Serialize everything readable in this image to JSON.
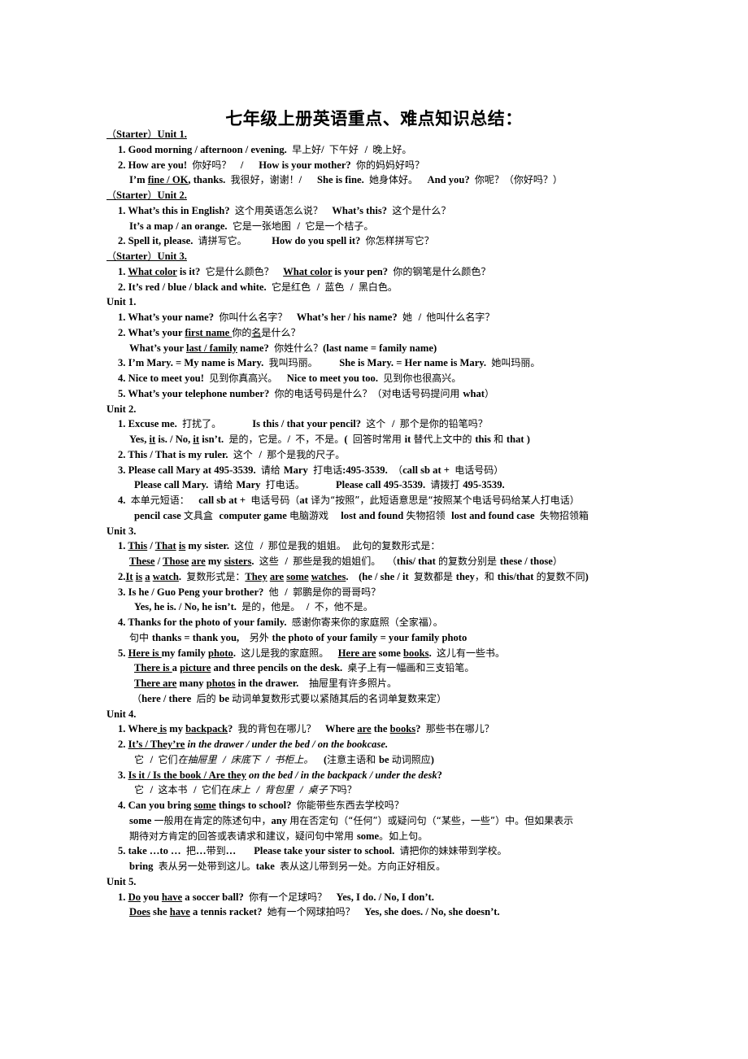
{
  "document": {
    "title": "七年级上册英语重点、难点知识总结：",
    "lines": [
      {
        "indent": 0,
        "segments": [
          {
            "t": "（Starter）Unit 1.",
            "u": true
          }
        ]
      },
      {
        "indent": 1,
        "segments": [
          {
            "t": "1. Good morning / afternoon / evening.  早上好/  下午好  /  晚上好。"
          }
        ]
      },
      {
        "indent": 1,
        "segments": [
          {
            "t": "2. How are you!  你好吗？   /      How is your mother?  你的妈妈好吗？"
          }
        ]
      },
      {
        "indent": 2,
        "segments": [
          {
            "t": "I’m "
          },
          {
            "t": "fine / OK",
            "u": true
          },
          {
            "t": ", thanks.  我很好，谢谢！/      She is fine.  她身体好。   And you?  你呢？（你好吗？）"
          }
        ]
      },
      {
        "indent": 0,
        "segments": [
          {
            "t": "（Starter）Unit 2.",
            "u": true
          }
        ]
      },
      {
        "indent": 1,
        "segments": [
          {
            "t": "1. What’s this in English?  这个用英语怎么说？   What’s this?  这个是什么？"
          }
        ]
      },
      {
        "indent": 2,
        "segments": [
          {
            "t": "It’s a map / an orange.  它是一张地图  /  它是一个桔子。"
          }
        ]
      },
      {
        "indent": 1,
        "segments": [
          {
            "t": "2. Spell it, please.  请拼写它。        How do you spell it?  你怎样拼写它？"
          }
        ]
      },
      {
        "indent": 0,
        "segments": [
          {
            "t": "（Starter）Unit 3.",
            "u": true
          }
        ]
      },
      {
        "indent": 1,
        "segments": [
          {
            "t": "1. "
          },
          {
            "t": "What color",
            "u": true
          },
          {
            "t": " is it?  它是什么颜色？   "
          },
          {
            "t": "What color",
            "u": true
          },
          {
            "t": " is your pen?  你的钢笔是什么颜色？"
          }
        ]
      },
      {
        "indent": 1,
        "segments": [
          {
            "t": "2. It’s red / blue / black and white.  它是红色  /  蓝色  /  黑白色。"
          }
        ]
      },
      {
        "indent": 0,
        "segments": [
          {
            "t": "Unit 1."
          }
        ]
      },
      {
        "indent": 1,
        "segments": [
          {
            "t": "1. What’s your name?  你叫什么名字？   What’s her / his name?  她  /  他叫什么名字？"
          }
        ]
      },
      {
        "indent": 1,
        "segments": [
          {
            "t": "2. What’s your "
          },
          {
            "t": "first name ",
            "u": true
          },
          {
            "t": "你的"
          },
          {
            "t": "名",
            "u": true
          },
          {
            "t": "是什么？"
          }
        ]
      },
      {
        "indent": 2,
        "segments": [
          {
            "t": "What’s your "
          },
          {
            "t": "last / family",
            "u": true
          },
          {
            "t": " name?  你姓什么？(last name = family name)"
          }
        ]
      },
      {
        "indent": 1,
        "segments": [
          {
            "t": "3. I’m Mary. = My name is Mary.  我叫玛丽。       She is Mary. = Her name is Mary.  她叫玛丽。"
          }
        ]
      },
      {
        "indent": 1,
        "segments": [
          {
            "t": "4. Nice to meet you!  见到你真高兴。   Nice to meet you too.  见到你也很高兴。"
          }
        ]
      },
      {
        "indent": 1,
        "segments": [
          {
            "t": "5. What’s your telephone number?  你的电话号码是什么？（对电话号码提问用 what）"
          }
        ]
      },
      {
        "indent": 0,
        "segments": [
          {
            "t": "Unit 2."
          }
        ]
      },
      {
        "indent": 1,
        "segments": [
          {
            "t": "1. Excuse me.  打扰了。          Is this / that your pencil?  这个  /  那个是你的铅笔吗？"
          }
        ]
      },
      {
        "indent": 2,
        "segments": [
          {
            "t": "Yes, "
          },
          {
            "t": "it",
            "u": true
          },
          {
            "t": " is. / No, "
          },
          {
            "t": "it",
            "u": true
          },
          {
            "t": " isn’t.  是的，它是。/  不，不是。(  回答时常用 it 替代上文中的 this 和 that )"
          }
        ]
      },
      {
        "indent": 1,
        "segments": [
          {
            "t": "2. This / That is my ruler.  这个  /  那个是我的尺子。"
          }
        ]
      },
      {
        "indent": 1,
        "segments": [
          {
            "t": "3. Please call Mary at 495-3539.  请给 Mary  打电话:495-3539.  （call sb at +  电话号码）"
          }
        ]
      },
      {
        "indent": 3,
        "segments": [
          {
            "t": "Please call Mary.  请给 Mary  打电话。          Please call 495-3539.  请拨打 495-3539."
          }
        ]
      },
      {
        "indent": 1,
        "segments": [
          {
            "t": "4.  本单元短语：   call sb at +  电话号码（at 译为“按照”，此短语意思是“按照某个电话号码给某人打电话）"
          }
        ]
      },
      {
        "indent": 3,
        "segments": [
          {
            "t": "pencil case 文具盒  computer game 电脑游戏    lost and found 失物招领  lost and found case  失物招领箱"
          }
        ]
      },
      {
        "indent": 0,
        "segments": [
          {
            "t": "Unit 3."
          }
        ]
      },
      {
        "indent": 1,
        "segments": [
          {
            "t": "1. "
          },
          {
            "t": "This",
            "u": true
          },
          {
            "t": " / "
          },
          {
            "t": "That",
            "u": true
          },
          {
            "t": " "
          },
          {
            "t": "is",
            "u": true
          },
          {
            "t": " my sister.  这位  /  那位是我的姐姐。  此句的复数形式是："
          }
        ]
      },
      {
        "indent": 2,
        "segments": [
          {
            "t": "These",
            "u": true
          },
          {
            "t": " / "
          },
          {
            "t": "Those",
            "u": true
          },
          {
            "t": " "
          },
          {
            "t": "are",
            "u": true
          },
          {
            "t": " my "
          },
          {
            "t": "sisters",
            "u": true
          },
          {
            "t": ".  这些  /  那些是我的姐姐们。  （this/ that 的复数分别是 these / those）"
          }
        ]
      },
      {
        "indent": 1,
        "segments": [
          {
            "t": "2."
          },
          {
            "t": "It",
            "u": true
          },
          {
            "t": " "
          },
          {
            "t": "is",
            "u": true
          },
          {
            "t": " "
          },
          {
            "t": "a",
            "u": true
          },
          {
            "t": " "
          },
          {
            "t": "watch",
            "u": true
          },
          {
            "t": ".  复数形式是："
          },
          {
            "t": "They",
            "u": true
          },
          {
            "t": " "
          },
          {
            "t": "are",
            "u": true
          },
          {
            "t": " "
          },
          {
            "t": "some",
            "u": true
          },
          {
            "t": " "
          },
          {
            "t": "watches",
            "u": true
          },
          {
            "t": ".    (he / she / it  复数都是 they，和 this/that 的复数不同)"
          }
        ]
      },
      {
        "indent": 1,
        "segments": [
          {
            "t": "3. Is he / Guo Peng your brother?  他  /  郭鹏是你的哥哥吗？"
          }
        ]
      },
      {
        "indent": 3,
        "segments": [
          {
            "t": "Yes, he is. / No, he isn’t.  是的，他是。  /  不，他不是。"
          }
        ]
      },
      {
        "indent": 1,
        "segments": [
          {
            "t": "4. Thanks for the photo of your family.  感谢你寄来你的家庭照（全家福）。"
          }
        ]
      },
      {
        "indent": 2,
        "segments": [
          {
            "t": "句中 thanks = thank you,    另外 the photo of your family = your family photo"
          }
        ]
      },
      {
        "indent": 1,
        "segments": [
          {
            "t": "5. "
          },
          {
            "t": "Here is ",
            "u": true
          },
          {
            "t": "my family "
          },
          {
            "t": "photo",
            "u": true
          },
          {
            "t": ".  这儿是我的家庭照。   "
          },
          {
            "t": "Here are",
            "u": true
          },
          {
            "t": " some "
          },
          {
            "t": "books",
            "u": true
          },
          {
            "t": ".  这儿有一些书。"
          }
        ]
      },
      {
        "indent": 3,
        "segments": [
          {
            "t": "There is ",
            "u": true
          },
          {
            "t": "a "
          },
          {
            "t": "picture",
            "u": true
          },
          {
            "t": " and three pencils on the desk.  桌子上有一幅画和三支铅笔。"
          }
        ]
      },
      {
        "indent": 3,
        "segments": [
          {
            "t": "There are",
            "u": true
          },
          {
            "t": " many "
          },
          {
            "t": "photos",
            "u": true
          },
          {
            "t": " in the drawer.    抽屉里有许多照片。"
          }
        ]
      },
      {
        "indent": 2,
        "segments": [
          {
            "t": " （here / there  后的 be 动词单复数形式要以紧随其后的名词单复数来定）"
          }
        ]
      },
      {
        "indent": 0,
        "segments": [
          {
            "t": "Unit 4."
          }
        ]
      },
      {
        "indent": 1,
        "segments": [
          {
            "t": "1. Where"
          },
          {
            "t": " is",
            "u": true
          },
          {
            "t": " my "
          },
          {
            "t": "backpack",
            "u": true
          },
          {
            "t": "?  我的背包在哪儿？   Where "
          },
          {
            "t": "are",
            "u": true
          },
          {
            "t": " the "
          },
          {
            "t": "books",
            "u": true
          },
          {
            "t": "?  那些书在哪儿？"
          }
        ]
      },
      {
        "indent": 1,
        "segments": [
          {
            "t": "2. "
          },
          {
            "t": "It’s / They’re",
            "u": true
          },
          {
            "t": " in the drawer / under the bed / on the bookcase.",
            "i": true
          }
        ]
      },
      {
        "indent": 3,
        "segments": [
          {
            "t": "它  /  它们"
          },
          {
            "t": "在抽屉里  /  床底下  /  书柜上。",
            "i": true
          },
          {
            "t": "    (注意主语和 be 动词照应)"
          }
        ]
      },
      {
        "indent": 1,
        "segments": [
          {
            "t": "3. "
          },
          {
            "t": "Is it / Is the book / Are they",
            "u": true
          },
          {
            "t": " on the bed / in the backpack / under the desk",
            "i": true
          },
          {
            "t": "?"
          }
        ]
      },
      {
        "indent": 3,
        "segments": [
          {
            "t": "它  /  这本书  /  它们在"
          },
          {
            "t": "床上  /  背包里  /  桌子下",
            "i": true
          },
          {
            "t": "吗？"
          }
        ]
      },
      {
        "indent": 1,
        "segments": [
          {
            "t": "4. Can you bring "
          },
          {
            "t": "some",
            "u": true
          },
          {
            "t": " things to school?  你能带些东西去学校吗？"
          }
        ]
      },
      {
        "indent": 2,
        "segments": [
          {
            "t": "some 一般用在肯定的陈述句中，any 用在否定句（“任何”）或疑问句（“某些，一些”）中。但如果表示"
          }
        ]
      },
      {
        "indent": 2,
        "segments": [
          {
            "t": "期待对方肯定的回答或表请求和建议，疑问句中常用 some。如上句。"
          }
        ]
      },
      {
        "indent": 1,
        "segments": [
          {
            "t": "5. take …to …  把…带到…       Please take your sister to school.  请把你的妹妹带到学校。"
          }
        ]
      },
      {
        "indent": 2,
        "segments": [
          {
            "t": "bring  表从另一处带到这儿。take  表从这儿带到另一处。方向正好相反。"
          }
        ]
      },
      {
        "indent": 0,
        "segments": [
          {
            "t": "Unit 5."
          }
        ]
      },
      {
        "indent": 1,
        "segments": [
          {
            "t": "1. "
          },
          {
            "t": "Do",
            "u": true
          },
          {
            "t": " you "
          },
          {
            "t": "have",
            "u": true
          },
          {
            "t": " a soccer ball?  你有一个足球吗？   Yes, I do. / No, I don’t."
          }
        ]
      },
      {
        "indent": 2,
        "segments": [
          {
            "t": "Does",
            "u": true
          },
          {
            "t": " she "
          },
          {
            "t": "have",
            "u": true
          },
          {
            "t": " a tennis racket?  她有一个网球拍吗？   Yes, she does. / No, she doesn’t."
          }
        ]
      }
    ]
  }
}
